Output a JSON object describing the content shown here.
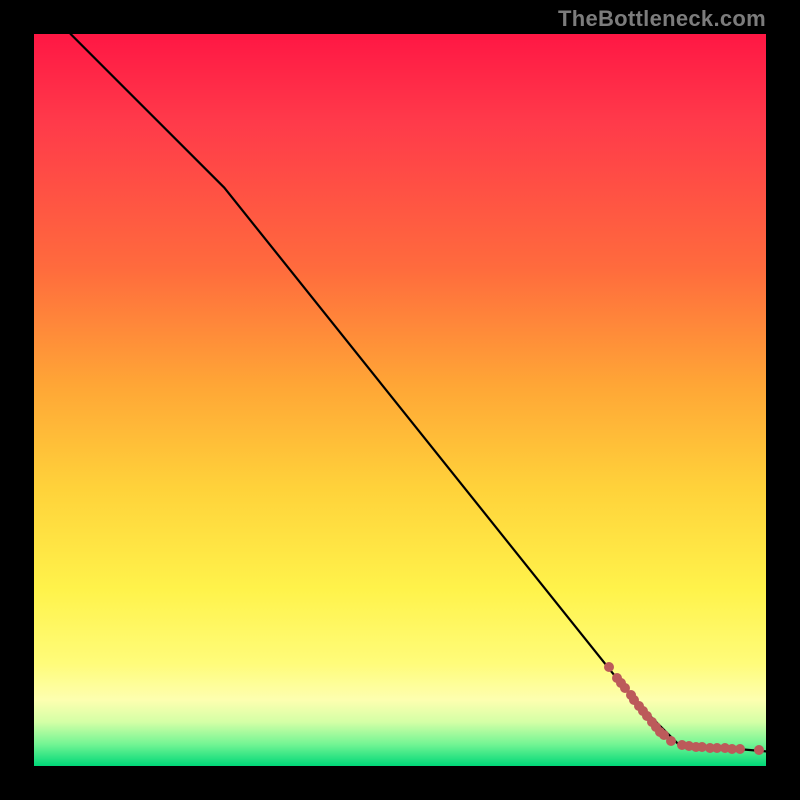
{
  "attribution": "TheBottleneck.com",
  "colors": {
    "bg": "#000000",
    "gradient_top": "#ff1744",
    "gradient_bottom": "#00d878",
    "marker": "#bc5a5a",
    "line": "#000000",
    "attribution_text": "#7c7c7c"
  },
  "chart_data": {
    "type": "line",
    "title": "",
    "xlabel": "",
    "ylabel": "",
    "xlim": [
      0,
      100
    ],
    "ylim": [
      0,
      100
    ],
    "grid": false,
    "line": {
      "name": "curve",
      "points": [
        {
          "x": 5,
          "y": 100
        },
        {
          "x": 26,
          "y": 79
        },
        {
          "x": 82,
          "y": 9
        },
        {
          "x": 88,
          "y": 3
        },
        {
          "x": 100,
          "y": 2
        }
      ]
    },
    "markers": {
      "name": "dots",
      "points": [
        {
          "x": 78.5,
          "y": 13.5
        },
        {
          "x": 79.7,
          "y": 12.0
        },
        {
          "x": 80.2,
          "y": 11.4
        },
        {
          "x": 80.8,
          "y": 10.6
        },
        {
          "x": 81.5,
          "y": 9.7
        },
        {
          "x": 82.0,
          "y": 9.0
        },
        {
          "x": 82.6,
          "y": 8.2
        },
        {
          "x": 83.2,
          "y": 7.5
        },
        {
          "x": 83.8,
          "y": 6.8
        },
        {
          "x": 84.4,
          "y": 6.0
        },
        {
          "x": 85.0,
          "y": 5.3
        },
        {
          "x": 85.5,
          "y": 4.7
        },
        {
          "x": 86.0,
          "y": 4.2
        },
        {
          "x": 87.0,
          "y": 3.4
        },
        {
          "x": 88.5,
          "y": 2.9
        },
        {
          "x": 89.5,
          "y": 2.7
        },
        {
          "x": 90.5,
          "y": 2.6
        },
        {
          "x": 91.3,
          "y": 2.55
        },
        {
          "x": 92.3,
          "y": 2.5
        },
        {
          "x": 93.3,
          "y": 2.45
        },
        {
          "x": 94.4,
          "y": 2.4
        },
        {
          "x": 95.4,
          "y": 2.35
        },
        {
          "x": 96.5,
          "y": 2.3
        },
        {
          "x": 99.0,
          "y": 2.2
        }
      ]
    }
  }
}
